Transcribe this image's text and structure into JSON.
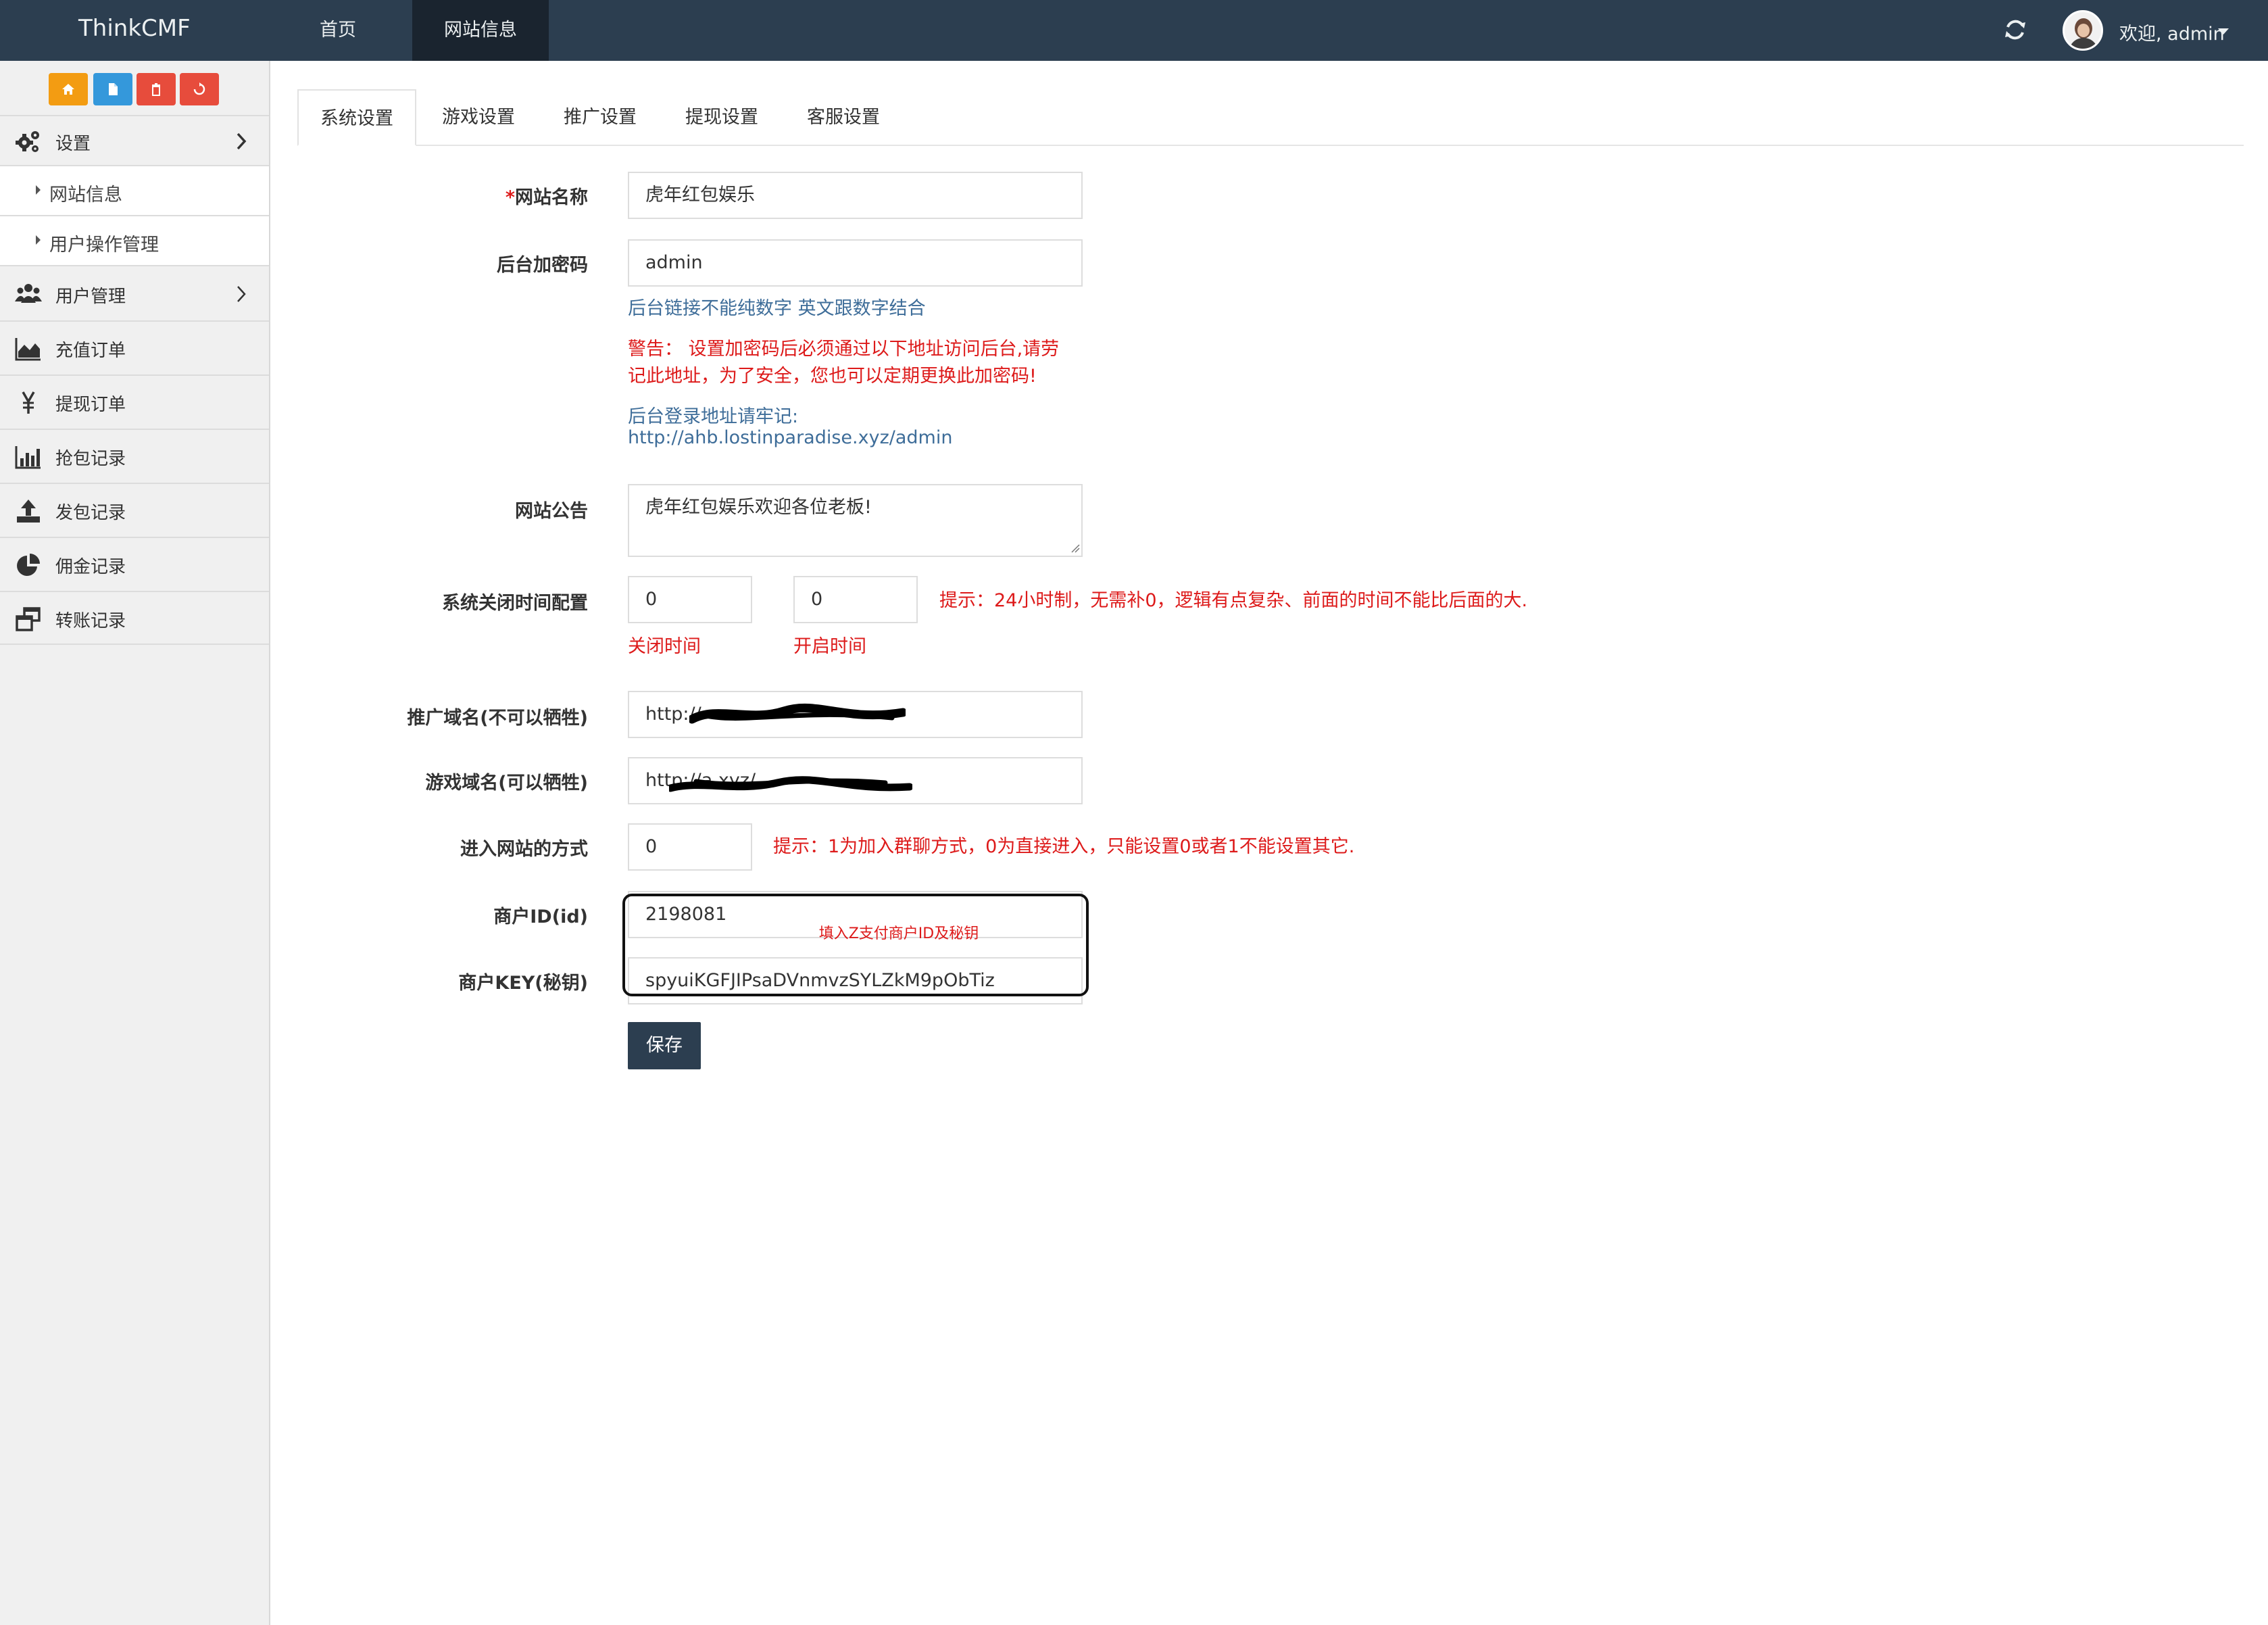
{
  "navbar": {
    "brand": "ThinkCMF",
    "tabs": [
      {
        "label": "首页",
        "active": false
      },
      {
        "label": "网站信息",
        "active": true
      }
    ],
    "user_greeting": "欢迎, admin",
    "bg_color": "#2c3e50"
  },
  "sidebar": {
    "shortcuts": [
      {
        "icon": "home-icon",
        "color": "#f39c12"
      },
      {
        "icon": "file-icon",
        "color": "#3498db"
      },
      {
        "icon": "trash-icon",
        "color": "#e74c3c"
      },
      {
        "icon": "recycle-icon",
        "color": "#e74c3c"
      }
    ],
    "menu": [
      {
        "label": "设置",
        "icon": "cogs-icon",
        "expanded": true
      },
      {
        "label": "网站信息",
        "sub": true
      },
      {
        "label": "用户操作管理",
        "sub": true
      },
      {
        "label": "用户管理",
        "icon": "users-icon"
      },
      {
        "label": "充值订单",
        "icon": "area-chart-icon"
      },
      {
        "label": "提现订单",
        "icon": "yen-icon"
      },
      {
        "label": "抢包记录",
        "icon": "bar-chart-icon"
      },
      {
        "label": "发包记录",
        "icon": "upload-icon"
      },
      {
        "label": "佣金记录",
        "icon": "pie-chart-icon"
      },
      {
        "label": "转账记录",
        "icon": "windows-icon"
      }
    ]
  },
  "content_tabs": [
    {
      "label": "系统设置",
      "active": true
    },
    {
      "label": "游戏设置",
      "active": false
    },
    {
      "label": "推广设置",
      "active": false
    },
    {
      "label": "提现设置",
      "active": false
    },
    {
      "label": "客服设置",
      "active": false
    }
  ],
  "form": {
    "site_name": {
      "required_mark": "*",
      "label": "网站名称",
      "value": "虎年红包娱乐"
    },
    "admin_password": {
      "label": "后台加密码",
      "value": "admin",
      "help": "后台链接不能纯数字 英文跟数字结合",
      "warning_line1": "警告：  设置加密码后必须通过以下地址访问后台,请劳",
      "warning_line2": "记此地址，为了安全，您也可以定期更换此加密码!",
      "login_hint": "后台登录地址请牢记:",
      "login_url": "http://ahb.lostinparadise.xyz/admin"
    },
    "notice": {
      "label": "网站公告",
      "value": "虎年红包娱乐欢迎各位老板!"
    },
    "close_time": {
      "label": "系统关闭时间配置",
      "close_value": "0",
      "open_value": "0",
      "close_caption": "关闭时间",
      "open_caption": "开启时间",
      "tip": "提示：24小时制，无需补0，逻辑有点复杂、前面的时间不能比后面的大."
    },
    "promo_domain": {
      "label": "推广域名(不可以牺牲)",
      "value": "http://"
    },
    "game_domain": {
      "label": "游戏域名(可以牺牲)",
      "value": "http://a                    xyz/"
    },
    "entry_mode": {
      "label": "进入网站的方式",
      "value": "0",
      "tip": "提示：1为加入群聊方式，0为直接进入，只能设置0或者1不能设置其它."
    },
    "merchant_id": {
      "label": "商户ID(id)",
      "value": "2198081"
    },
    "merchant_key": {
      "label": "商户KEY(秘钥)",
      "value": "spyuiKGFJIPsaDVnmvzSYLZkM9pObTiz"
    },
    "annotation": "填入Z支付商户ID及秘钥",
    "save_label": "保存"
  }
}
